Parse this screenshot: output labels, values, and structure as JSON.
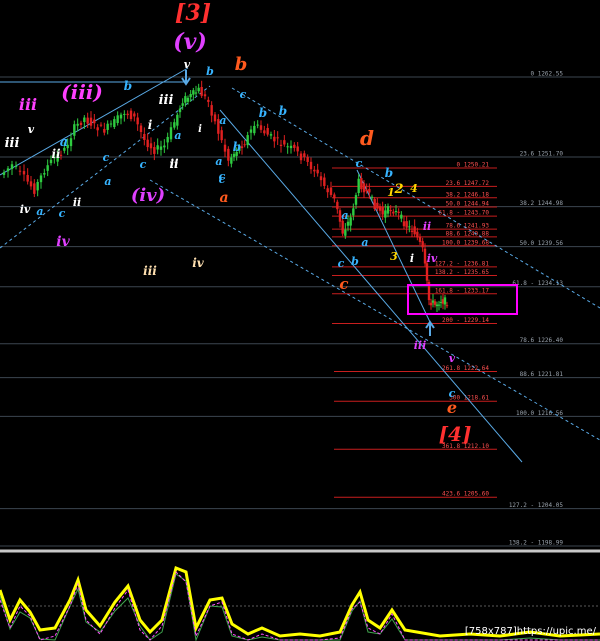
{
  "chart_data": {
    "type": "candlestick",
    "instrument_note": "",
    "y_axis": {
      "ylim": [
        1196.0,
        1264.0
      ]
    },
    "fibonacci_grey": [
      {
        "label": "0 1262.55",
        "price": 1262.55
      },
      {
        "label": "23.6 1251.70",
        "price": 1251.7
      },
      {
        "label": "38.2 1244.98",
        "price": 1244.98
      },
      {
        "label": "50.0 1239.56",
        "price": 1239.56
      },
      {
        "label": "61.8 - 1234.13",
        "price": 1234.13
      },
      {
        "label": "78.6 1226.40",
        "price": 1226.4
      },
      {
        "label": "88.6 1221.81",
        "price": 1221.81
      },
      {
        "label": "100.0 1216.56",
        "price": 1216.56
      },
      {
        "label": "127.2 - 1204.05",
        "price": 1204.05
      },
      {
        "label": "138.2 - 1198.99",
        "price": 1198.99
      }
    ],
    "fibonacci_red": [
      {
        "label": "0 1250.21",
        "price": 1250.21
      },
      {
        "label": "23.6 1247.72",
        "price": 1247.72
      },
      {
        "label": "38.2 1246.18",
        "price": 1246.18
      },
      {
        "label": "50.0 1244.94",
        "price": 1244.94
      },
      {
        "label": "61.8 - 1243.70",
        "price": 1243.7
      },
      {
        "label": "78.6 1241.93",
        "price": 1241.93
      },
      {
        "label": "88.6 1240.88",
        "price": 1240.88
      },
      {
        "label": "100.0 1239.68",
        "price": 1239.68
      },
      {
        "label": "127.2 - 1236.81",
        "price": 1236.81
      },
      {
        "label": "138.2 - 1235.65",
        "price": 1235.65
      },
      {
        "label": "161.8 - 1233.17",
        "price": 1233.17
      },
      {
        "label": "200 - 1229.14",
        "price": 1229.14
      },
      {
        "label": "261.8 1222.64",
        "price": 1222.64
      },
      {
        "label": "300 1218.61",
        "price": 1218.61
      },
      {
        "label": "361.8 1212.10",
        "price": 1212.1
      },
      {
        "label": "423.6 1205.60",
        "price": 1205.6
      }
    ],
    "wave_labels": [
      {
        "text": "[3]",
        "color": "#ff3030"
      },
      {
        "text": "(v)",
        "color": "#e040ff"
      },
      {
        "text": "v",
        "color": "#ffffff"
      },
      {
        "text": "b",
        "color": "#ff5a1e"
      },
      {
        "text": "b",
        "color": "#37b4ff"
      },
      {
        "text": "iii",
        "color": "#ff40ff"
      },
      {
        "text": "(iii)",
        "color": "#ff40ff"
      },
      {
        "text": "b",
        "color": "#37b4ff"
      },
      {
        "text": "v",
        "color": "#ffffff"
      },
      {
        "text": "iii",
        "color": "#ffffff"
      },
      {
        "text": "iii",
        "color": "#ffffff"
      },
      {
        "text": "i",
        "color": "#ffffff"
      },
      {
        "text": "b",
        "color": "#37b4ff"
      },
      {
        "text": "c",
        "color": "#37b4ff"
      },
      {
        "text": "a",
        "color": "#37b4ff"
      },
      {
        "text": "b",
        "color": "#37b4ff"
      },
      {
        "text": "a",
        "color": "#37b4ff"
      },
      {
        "text": "i",
        "color": "#ffffff"
      },
      {
        "text": "a",
        "color": "#37b4ff"
      },
      {
        "text": "ii",
        "color": "#ffffff"
      },
      {
        "text": "c",
        "color": "#37b4ff"
      },
      {
        "text": "ii",
        "color": "#ffffff"
      },
      {
        "text": "b",
        "color": "#37b4ff"
      },
      {
        "text": "a",
        "color": "#37b4ff"
      },
      {
        "text": "c",
        "color": "#37b4ff"
      },
      {
        "text": "ii",
        "color": "#ffffff"
      },
      {
        "text": "c",
        "color": "#37b4ff"
      },
      {
        "text": "a",
        "color": "#37b4ff"
      },
      {
        "text": "(iv)",
        "color": "#e040ff"
      },
      {
        "text": "c",
        "color": "#37b4ff"
      },
      {
        "text": "a",
        "color": "#ff5a1e"
      },
      {
        "text": "iv",
        "color": "#ffffff"
      },
      {
        "text": "a",
        "color": "#37b4ff"
      },
      {
        "text": "c",
        "color": "#37b4ff"
      },
      {
        "text": "ii",
        "color": "#ffffff"
      },
      {
        "text": "iv",
        "color": "#e040ff"
      },
      {
        "text": "iii",
        "color": "#ffe0b0"
      },
      {
        "text": "iv",
        "color": "#ffe0b0"
      },
      {
        "text": "d",
        "color": "#ff5a1e"
      },
      {
        "text": "c",
        "color": "#37b4ff"
      },
      {
        "text": "b",
        "color": "#37b4ff"
      },
      {
        "text": "2",
        "color": "#ffd700"
      },
      {
        "text": "1",
        "color": "#ffd700"
      },
      {
        "text": "4",
        "color": "#ffd700"
      },
      {
        "text": "a",
        "color": "#37b4ff"
      },
      {
        "text": "ii",
        "color": "#e040ff"
      },
      {
        "text": "a",
        "color": "#37b4ff"
      },
      {
        "text": "3",
        "color": "#ffd700"
      },
      {
        "text": "i",
        "color": "#ffffff"
      },
      {
        "text": "iv",
        "color": "#e040ff"
      },
      {
        "text": "c",
        "color": "#37b4ff"
      },
      {
        "text": "b",
        "color": "#37b4ff"
      },
      {
        "text": "c",
        "color": "#ff5a1e"
      },
      {
        "text": "iii",
        "color": "#e040ff"
      },
      {
        "text": "v",
        "color": "#e040ff"
      },
      {
        "text": "c",
        "color": "#37b4ff"
      },
      {
        "text": "e",
        "color": "#ff5a1e"
      },
      {
        "text": "[4]",
        "color": "#ff3030"
      }
    ],
    "colors": {
      "background": "#000000",
      "bull_candle": "#2ecc40",
      "bear_candle": "#e02020",
      "fib_grey": "#3c4650",
      "fib_red": "#c81e1e",
      "channel": "#5aaae6",
      "target_box": "#ff00ff",
      "oscillator": "#ffff00"
    },
    "indicator_panel": {
      "type": "oscillator",
      "color": "#ffff00"
    }
  },
  "watermark": "[758x787]https://upic.me/"
}
